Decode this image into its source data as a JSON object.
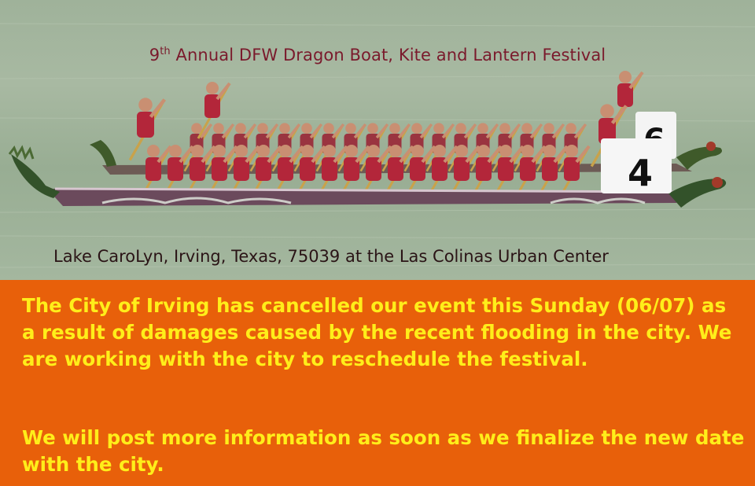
{
  "title": {
    "ordinal_number": "9",
    "ordinal_suffix": "th",
    "rest": "Annual DFW Dragon Boat, Kite and Lantern Festival"
  },
  "location": "Lake CaroLyn, Irving, Texas, 75039 at the Las Colinas Urban Center",
  "notice": {
    "paragraph1": "The City of Irving has cancelled our event this Sunday (06/07) as a result of damages caused by the recent flooding in the city. We are working with the city to reschedule the festival.",
    "paragraph2": "We will post more information as soon as we finalize the new date with the city."
  },
  "boat_numbers": [
    "4",
    "6"
  ],
  "colors": {
    "water": "#a2b59c",
    "title_text": "#7a1a2c",
    "notice_bg": "#e8600a",
    "notice_text": "#ffee1a"
  }
}
